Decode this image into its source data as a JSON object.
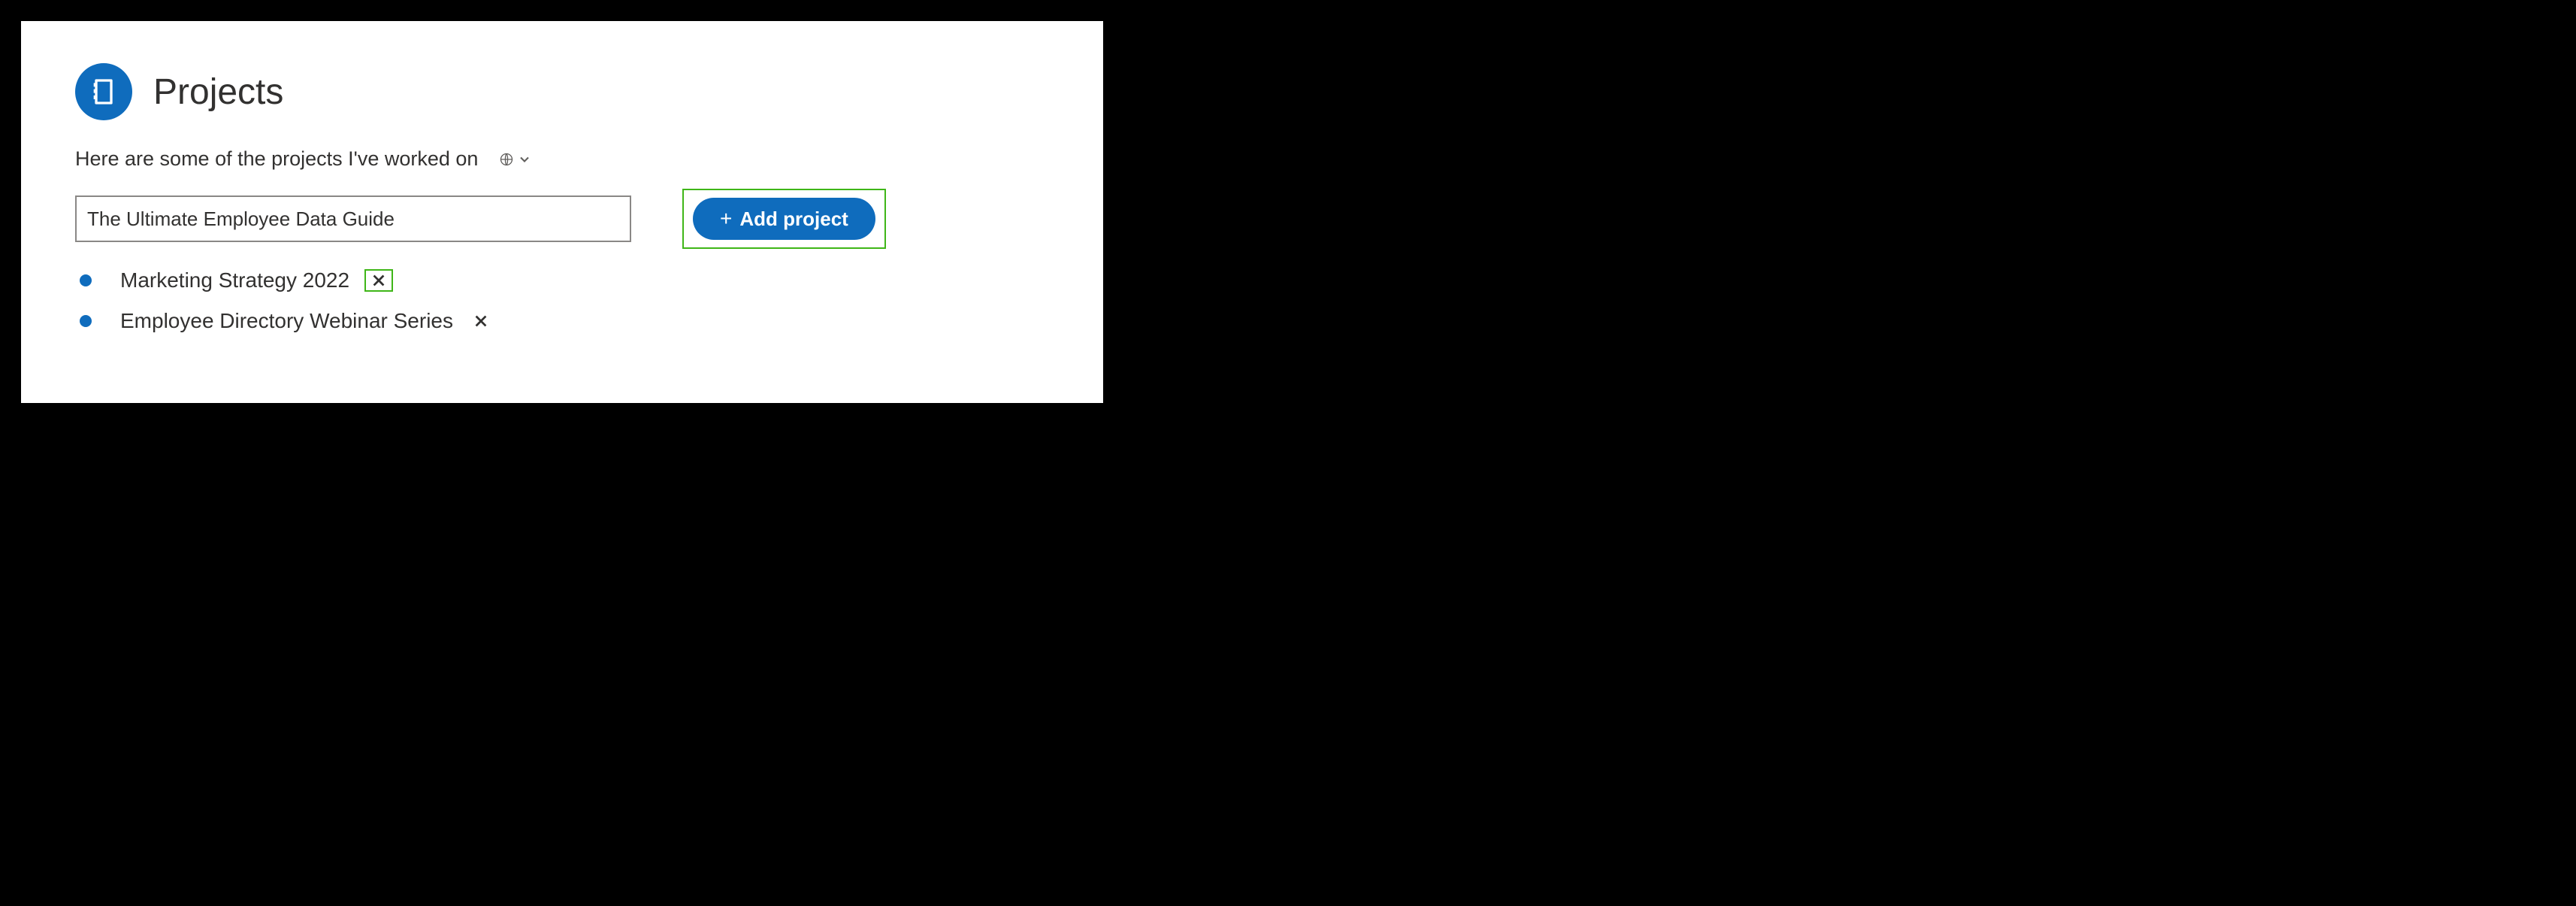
{
  "header": {
    "title": "Projects",
    "icon_name": "notebook-icon"
  },
  "description": "Here are some of the projects I've worked on",
  "input": {
    "value": "The Ultimate Employee Data Guide"
  },
  "add_button": {
    "label": "Add project"
  },
  "projects": [
    {
      "label": "Marketing Strategy 2022",
      "highlighted_remove": true
    },
    {
      "label": "Employee Directory Webinar Series",
      "highlighted_remove": false
    }
  ]
}
